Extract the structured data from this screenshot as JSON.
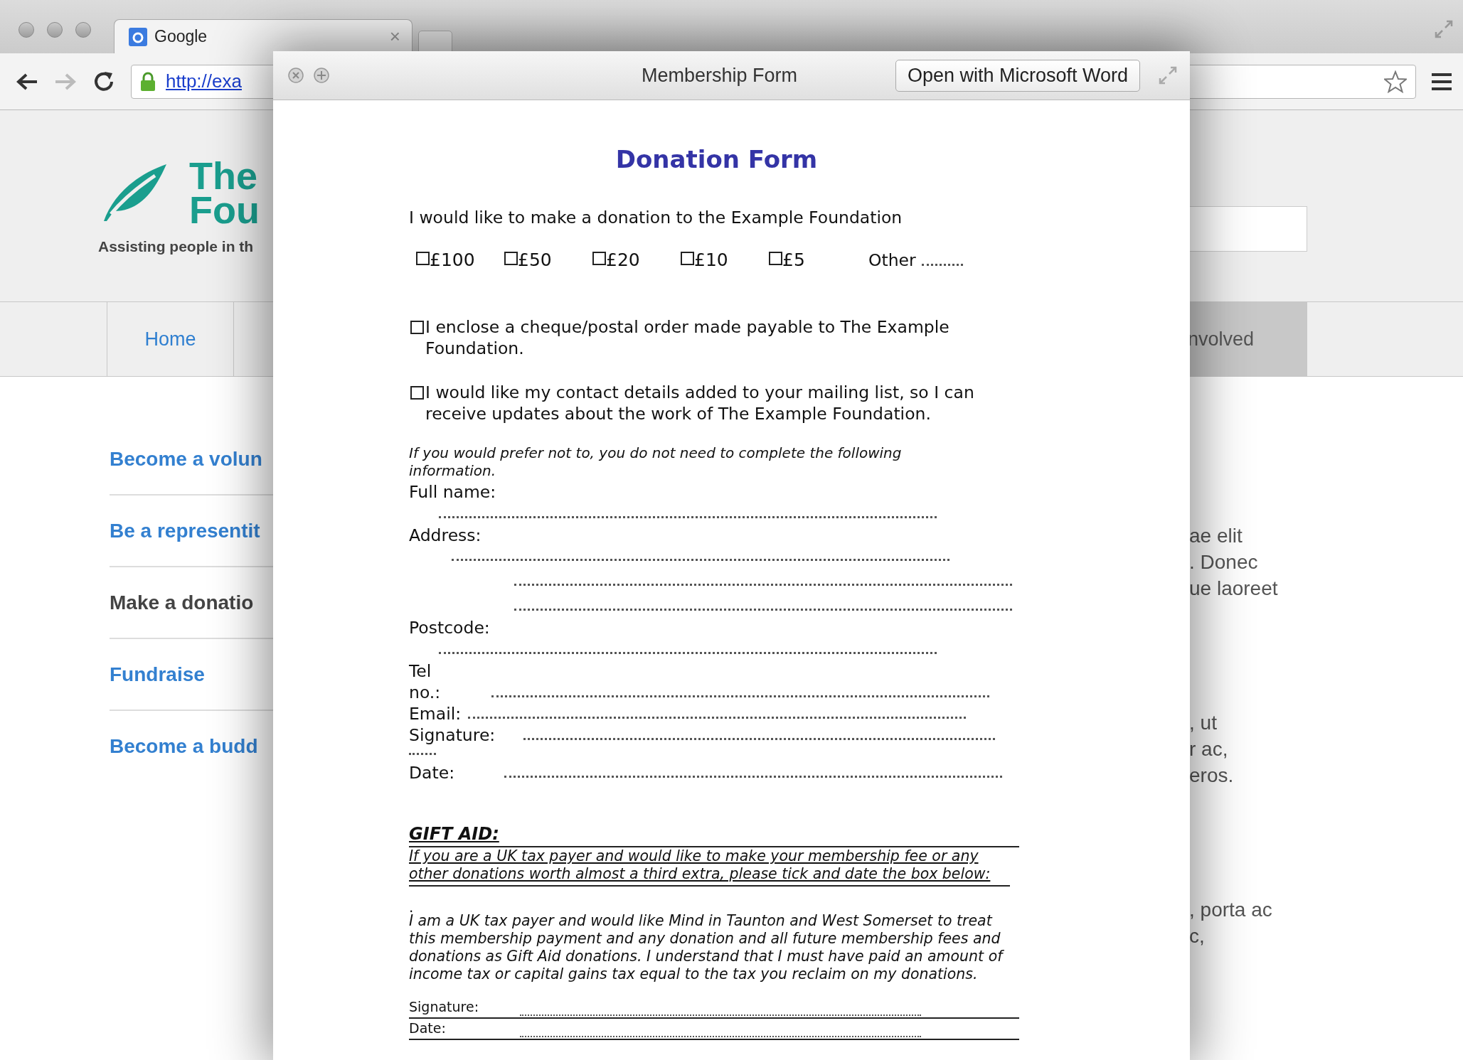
{
  "browser": {
    "tab_title": "Google",
    "tab_close": "×",
    "url": "http://exa"
  },
  "site": {
    "logo_lines": [
      "The",
      "Fou"
    ],
    "tagline": "Assisting people in th",
    "nav_left": [
      {
        "label": "Home",
        "selected": false
      }
    ],
    "nav_right": [
      {
        "label": "nvolved",
        "selected": true
      }
    ],
    "sidebar": [
      {
        "label": "Become a volun",
        "selected": false
      },
      {
        "label": "Be a representit",
        "selected": false
      },
      {
        "label": "Make a donatio",
        "selected": true
      },
      {
        "label": "Fundraise",
        "selected": false
      },
      {
        "label": "Become a budd",
        "selected": false
      }
    ],
    "content_fragments": [
      [
        "ae elit",
        ". Donec",
        "ue laoreet"
      ],
      [
        ", ut",
        "r ac,",
        "eros."
      ],
      [
        ", porta ac",
        "c,"
      ]
    ]
  },
  "viewer": {
    "title": "Membership Form",
    "open_button": "Open with Microsoft Word",
    "form": {
      "heading": "Donation Form",
      "intro": "I would like to make a donation to the Example Foundation",
      "amounts": [
        {
          "label": "£100",
          "checked": false
        },
        {
          "label": "£50",
          "checked": false
        },
        {
          "label": "£20",
          "checked": false
        },
        {
          "label": "£10",
          "checked": false
        },
        {
          "label": "£5",
          "checked": false
        }
      ],
      "other_label": "Other",
      "options": [
        {
          "text": "I enclose a cheque/postal order made payable to The Example Foundation.",
          "checked": false
        },
        {
          "text": "I would like my contact details added to your mailing list, so I can receive updates about the work of The Example Foundation.",
          "checked": false
        }
      ],
      "note": "If you would prefer not to, you do not need to complete the following information.",
      "fields": [
        {
          "label": "Full name:",
          "kind": "below"
        },
        {
          "label": "Address:",
          "kind": "below-multi"
        },
        {
          "label": "Postcode:",
          "kind": "below"
        },
        {
          "label": "Tel no.:",
          "kind": "inline-wrapped"
        },
        {
          "label": "Email:",
          "kind": "inline"
        },
        {
          "label": "Signature:",
          "kind": "inline-overflow"
        },
        {
          "label": "Date:",
          "kind": "inline-wide"
        }
      ],
      "gift_aid": {
        "heading": "GIFT AID:",
        "intro": "If you are a UK tax payer and would like to make your membership fee or any other donations worth almost a third extra, please tick and date the box below:",
        "marker": ".",
        "declaration": "I am a UK tax payer and would like Mind in Taunton and West Somerset to treat this membership payment and any donation and all future membership fees and donations as Gift Aid donations.  I understand that I must have paid an amount of income tax or capital gains tax equal to the tax you reclaim on my donations.",
        "sign_fields": [
          {
            "label": "Signature:"
          },
          {
            "label": "Date:"
          }
        ]
      }
    }
  }
}
